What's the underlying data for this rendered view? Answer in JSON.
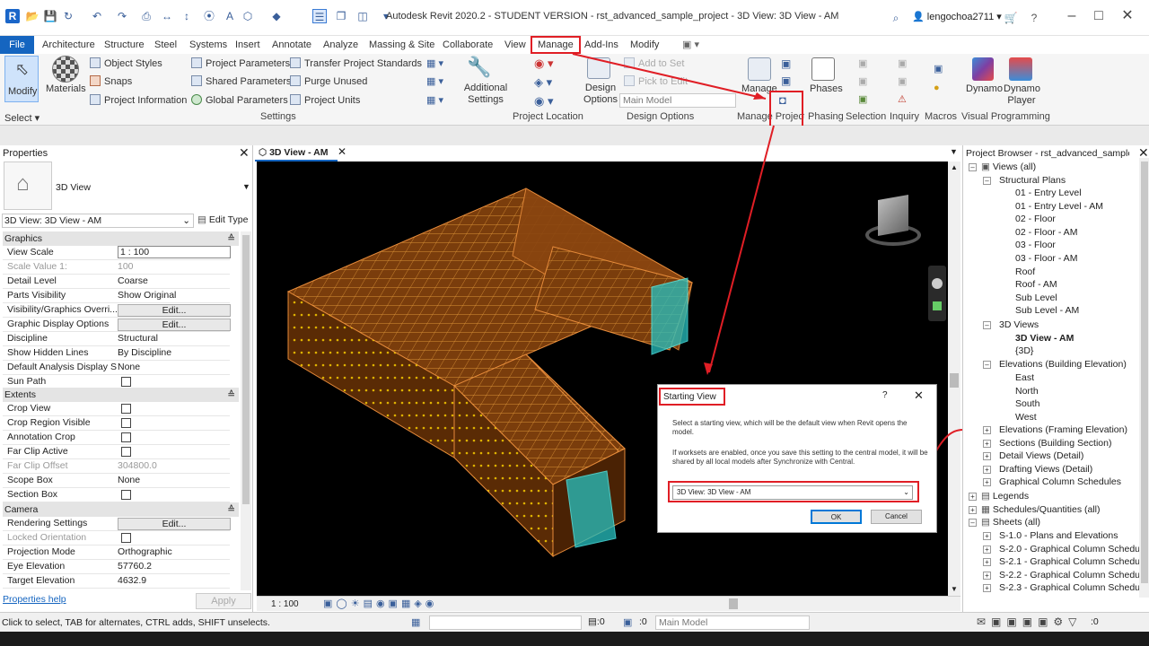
{
  "titlebar": {
    "title": "Autodesk Revit 2020.2 - STUDENT VERSION - rst_advanced_sample_project - 3D View: 3D View - AM",
    "user": "lengochoa2711"
  },
  "tabs": [
    "File",
    "Architecture",
    "Structure",
    "Steel",
    "Systems",
    "Insert",
    "Annotate",
    "Analyze",
    "Massing & Site",
    "Collaborate",
    "View",
    "Manage",
    "Add-Ins",
    "Modify"
  ],
  "ribbon": {
    "modify": "Modify",
    "select": "Select",
    "materials": "Materials",
    "object_styles": "Object  Styles",
    "snaps": "Snaps",
    "project_information": "Project  Information",
    "project_parameters": "Project  Parameters",
    "shared_parameters": "Shared  Parameters",
    "global_parameters": "Global  Parameters",
    "transfer_standards": "Transfer  Project Standards",
    "purge_unused": "Purge  Unused",
    "project_units": "Project  Units",
    "settings_group": "Settings",
    "additional_settings": "Additional Settings",
    "project_location": "Project Location",
    "design_options_btn": "Design Options",
    "add_to_set": "Add to Set",
    "pick_to_edit": "Pick to Edit",
    "main_model": "Main Model",
    "design_options_group": "Design Options",
    "manage_links": "Manage Links",
    "manage_project": "Manage Project",
    "phases": "Phases",
    "phasing": "Phasing",
    "selection": "Selection",
    "inquiry": "Inquiry",
    "macros": "Macros",
    "dynamo": "Dynamo",
    "dynamo_player": "Dynamo Player",
    "visual_programming": "Visual Programming"
  },
  "properties": {
    "header": "Properties",
    "type_name": "3D View",
    "instance": "3D View: 3D View - AM",
    "edit_type": "Edit Type",
    "sections": {
      "graphics": "Graphics",
      "extents": "Extents",
      "camera": "Camera"
    },
    "graphics_rows": [
      {
        "k": "View Scale",
        "v": "1 : 100"
      },
      {
        "k": "Scale Value    1:",
        "v": "100"
      },
      {
        "k": "Detail Level",
        "v": "Coarse"
      },
      {
        "k": "Parts Visibility",
        "v": "Show Original"
      },
      {
        "k": "Visibility/Graphics Overri...",
        "v": "Edit..."
      },
      {
        "k": "Graphic Display Options",
        "v": "Edit..."
      },
      {
        "k": "Discipline",
        "v": "Structural"
      },
      {
        "k": "Show Hidden Lines",
        "v": "By Discipline"
      },
      {
        "k": "Default Analysis Display S...",
        "v": "None"
      },
      {
        "k": "Sun Path",
        "v": ""
      }
    ],
    "extents_rows": [
      {
        "k": "Crop View",
        "v": ""
      },
      {
        "k": "Crop Region Visible",
        "v": ""
      },
      {
        "k": "Annotation Crop",
        "v": ""
      },
      {
        "k": "Far Clip Active",
        "v": ""
      },
      {
        "k": "Far Clip Offset",
        "v": "304800.0"
      },
      {
        "k": "Scope Box",
        "v": "None"
      },
      {
        "k": "Section Box",
        "v": ""
      }
    ],
    "camera_rows": [
      {
        "k": "Rendering Settings",
        "v": "Edit..."
      },
      {
        "k": "Locked Orientation",
        "v": ""
      },
      {
        "k": "Projection Mode",
        "v": "Orthographic"
      },
      {
        "k": "Eye Elevation",
        "v": "57760.2"
      },
      {
        "k": "Target Elevation",
        "v": "4632.9"
      }
    ],
    "help": "Properties help",
    "apply": "Apply"
  },
  "view": {
    "tab": "3D View - AM",
    "scale": "1 : 100"
  },
  "dialog": {
    "title": "Starting View",
    "help": "?",
    "text1": "Select a starting view, which will be the default view when Revit opens the model.",
    "text2": "If worksets are enabled, once you save this setting to the central model, it will be shared by all local models after Synchronize with Central.",
    "selected": "3D View: 3D View - AM",
    "ok": "OK",
    "cancel": "Cancel"
  },
  "browser": {
    "header": "Project Browser - rst_advanced_sample_p...",
    "views_all": "Views (all)",
    "structural_plans": "Structural Plans",
    "plans": [
      "01 - Entry Level",
      "01 - Entry Level - AM",
      "02 - Floor",
      "02 - Floor - AM",
      "03 - Floor",
      "03 - Floor - AM",
      "Roof",
      "Roof - AM",
      "Sub Level",
      "Sub Level - AM"
    ],
    "views_3d": "3D Views",
    "views_3d_items": [
      "3D View - AM",
      "{3D}"
    ],
    "elevations_building": "Elevations (Building Elevation)",
    "elevations": [
      "East",
      "North",
      "South",
      "West"
    ],
    "other_groups": [
      "Elevations (Framing Elevation)",
      "Sections (Building Section)",
      "Detail Views (Detail)",
      "Drafting Views (Detail)",
      "Graphical Column Schedules"
    ],
    "legends": "Legends",
    "schedules": "Schedules/Quantities (all)",
    "sheets": "Sheets (all)",
    "sheet_items": [
      "S-1.0 - Plans and Elevations",
      "S-2.0 - Graphical Column Schedule",
      "S-2.1 - Graphical Column Schedule",
      "S-2.2 - Graphical Column Schedule",
      "S-2.3 - Graphical Column Schedule"
    ]
  },
  "status": {
    "message": "Click to select, TAB for alternates, CTRL adds, SHIFT unselects.",
    "zero1": ":0",
    "zero2": ":0",
    "main_model": "Main Model",
    "filter_count": ":0"
  }
}
